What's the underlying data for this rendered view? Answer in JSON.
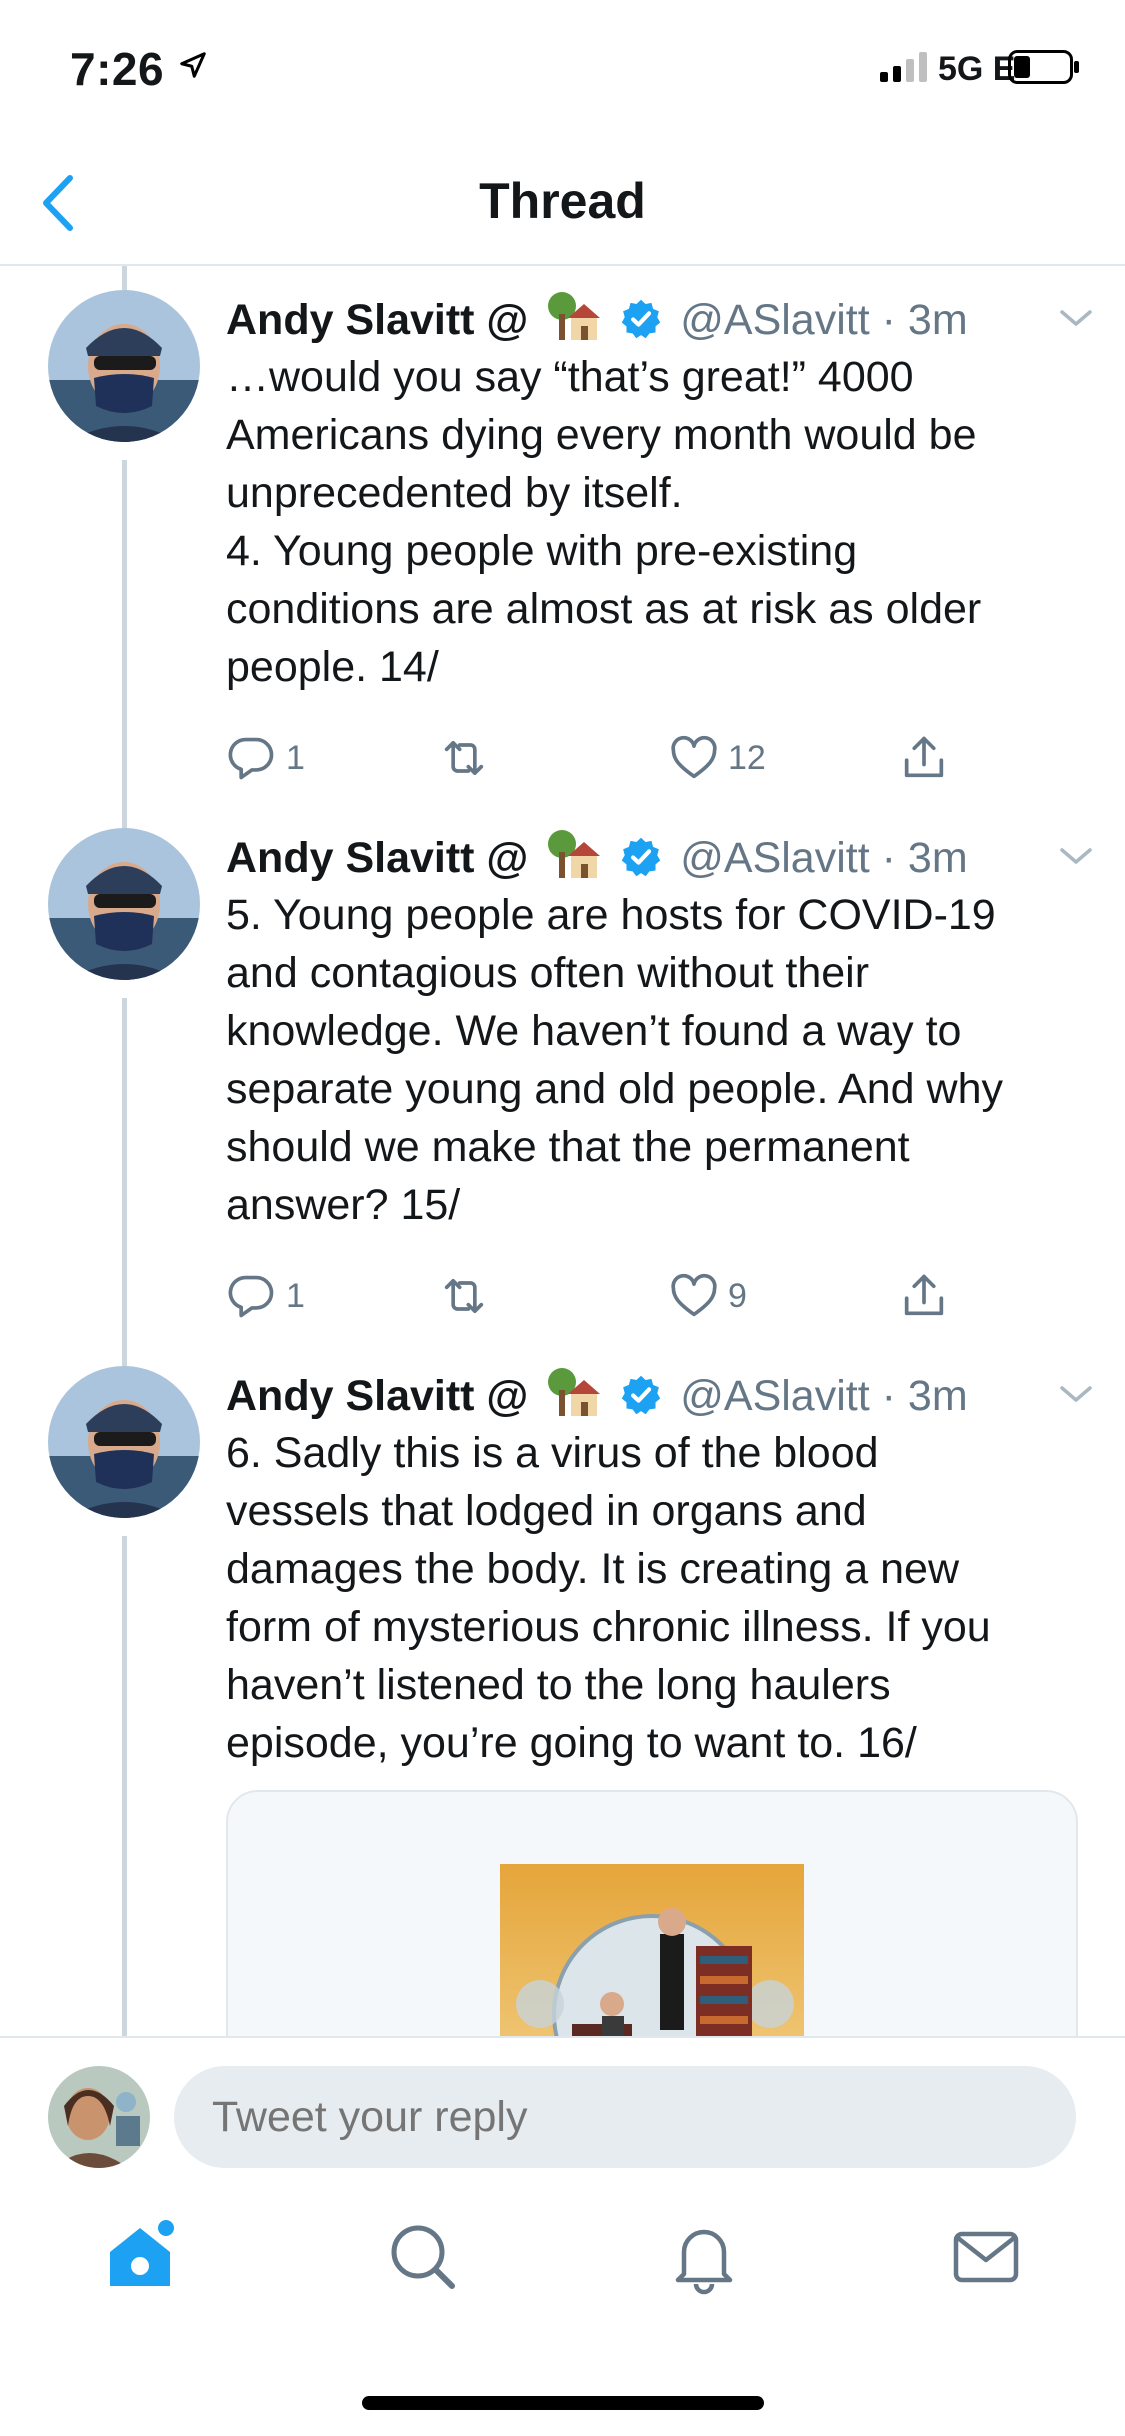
{
  "status": {
    "time": "7:26",
    "network": "5G E"
  },
  "header": {
    "title": "Thread"
  },
  "tweets": [
    {
      "name": "Andy Slavitt @",
      "handle": "@ASlavitt",
      "separator": "·",
      "time": "3m",
      "text": "…would you say “that’s great!” 4000\nAmericans dying every month would be\nunprecedented by itself.\n4. Young people with pre-existing\nconditions are almost as at risk as older\npeople. 14/",
      "replies": "1",
      "likes": "12"
    },
    {
      "name": "Andy Slavitt @",
      "handle": "@ASlavitt",
      "separator": "·",
      "time": "3m",
      "text": "5. Young people are hosts for COVID-19\nand contagious often without their\nknowledge. We haven’t found a way to\nseparate young and old people. And why\nshould we make that the permanent\nanswer? 15/",
      "replies": "1",
      "likes": "9"
    },
    {
      "name": "Andy Slavitt @",
      "handle": "@ASlavitt",
      "separator": "·",
      "time": "3m",
      "text": "6. Sadly this is a virus of the blood\nvessels that lodged in organs and\ndamages the body. It is creating a new\nform of mysterious chronic illness. If you\nhaven’t listened to the long haulers\nepisode, you’re going to want to. 16/"
    }
  ],
  "reply": {
    "placeholder": "Tweet your reply"
  },
  "colors": {
    "accent": "#1da1f2",
    "muted": "#657786",
    "divider": "#e1e8ed"
  },
  "icons": [
    "back-chevron-icon",
    "verified-badge-icon",
    "house-tree-emoji-icon",
    "reply-icon",
    "retweet-icon",
    "like-icon",
    "share-icon",
    "home-icon",
    "search-icon",
    "notifications-icon",
    "messages-icon"
  ]
}
